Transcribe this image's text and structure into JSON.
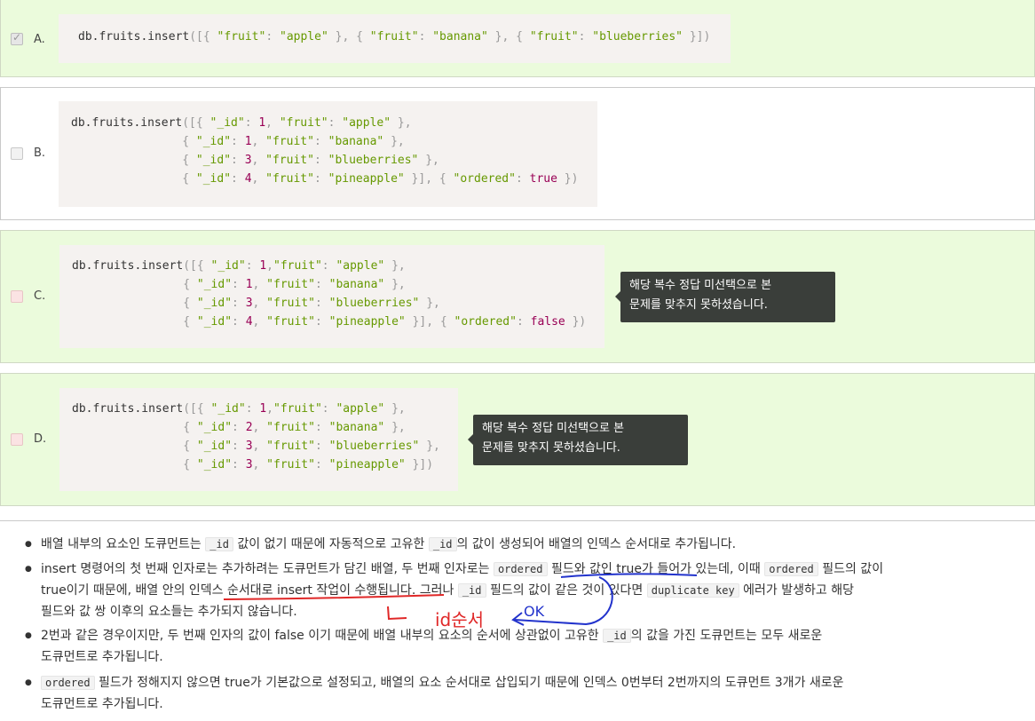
{
  "options": {
    "a": {
      "letter": "A."
    },
    "b": {
      "letter": "B."
    },
    "c": {
      "letter": "C.",
      "tooltip_line1": "해당 복수 정답 미선택으로 본",
      "tooltip_line2": "문제를 맞추지 못하셨습니다."
    },
    "d": {
      "letter": "D.",
      "tooltip_line1": "해당 복수 정답 미선택으로 본",
      "tooltip_line2": "문제를 맞추지 못하셨습니다."
    }
  },
  "code": {
    "a": [
      "db.fruits.insert([{ \"fruit\": \"apple\" }, { \"fruit\": \"banana\" }, { \"fruit\": \"blueberries\" }])"
    ],
    "b": [
      "db.fruits.insert([{ \"_id\": 1, \"fruit\": \"apple\" },",
      "                  { \"_id\": 1, \"fruit\": \"banana\" },",
      "                  { \"_id\": 3, \"fruit\": \"blueberries\" },",
      "                  { \"_id\": 4, \"fruit\": \"pineapple\" }], { \"ordered\": true })"
    ],
    "c": [
      "db.fruits.insert([{ \"_id\": 1,\"fruit\": \"apple\" },",
      "                  { \"_id\": 1, \"fruit\": \"banana\" },",
      "                  { \"_id\": 3, \"fruit\": \"blueberries\" },",
      "                  { \"_id\": 4, \"fruit\": \"pineapple\" }], { \"ordered\": false })"
    ],
    "d": [
      "db.fruits.insert([{ \"_id\": 1,\"fruit\": \"apple\" },",
      "                  { \"_id\": 2, \"fruit\": \"banana\" },",
      "                  { \"_id\": 3, \"fruit\": \"blueberries\" },",
      "                  { \"_id\": 3, \"fruit\": \"pineapple\" }])"
    ]
  },
  "explanation": {
    "b1_a": "배열 내부의 요소인 도큐먼트는",
    "b1_code1": "_id",
    "b1_b": "값이 없기 때문에 자동적으로 고유한",
    "b1_code2": "_id",
    "b1_c": "의 값이 생성되어 배열의 인덱스 순서대로 추가됩니다.",
    "b2_a": "insert 명령어의 첫 번째 인자로는 추가하려는 도큐먼트가 담긴 배열, 두 번째 인자로는",
    "b2_code1": "ordered",
    "b2_b": "필드와 값인 true가 들어가 있는데, 이때",
    "b2_code2": "ordered",
    "b2_c": "필드의 값이",
    "b2_d": "true이기 때문에, 배열 안의 인덱스 순서대로 insert 작업이 수행됩니다. 그러나",
    "b2_code3": "_id",
    "b2_e": "필드의 값이 같은 것이 있다면",
    "b2_code4": "duplicate key",
    "b2_f": "에러가 발생하고 해당",
    "b2_g": "필드와 값 쌍 이후의 요소들는 추가되지 않습니다.",
    "b3_a": "2번과 같은 경우이지만, 두 번째 인자의 값이 false 이기 때문에 배열 내부의 요소의 순서에 상관없이 고유한",
    "b3_code1": "_id",
    "b3_b": "의 값을 가진 도큐먼트는 모두 새로운",
    "b3_c": "도큐먼트로 추가됩니다.",
    "b4_code1": "ordered",
    "b4_a": "필드가 정해지지 않으면 true가 기본값으로 설정되고, 배열의 요소 순서대로 삽입되기 때문에 인덱스 0번부터 2번까지의 도큐먼트 3개가 새로운",
    "b4_b": "도큐먼트로 추가됩니다."
  },
  "annotations": {
    "note1": "id순서",
    "note2": "OK"
  }
}
